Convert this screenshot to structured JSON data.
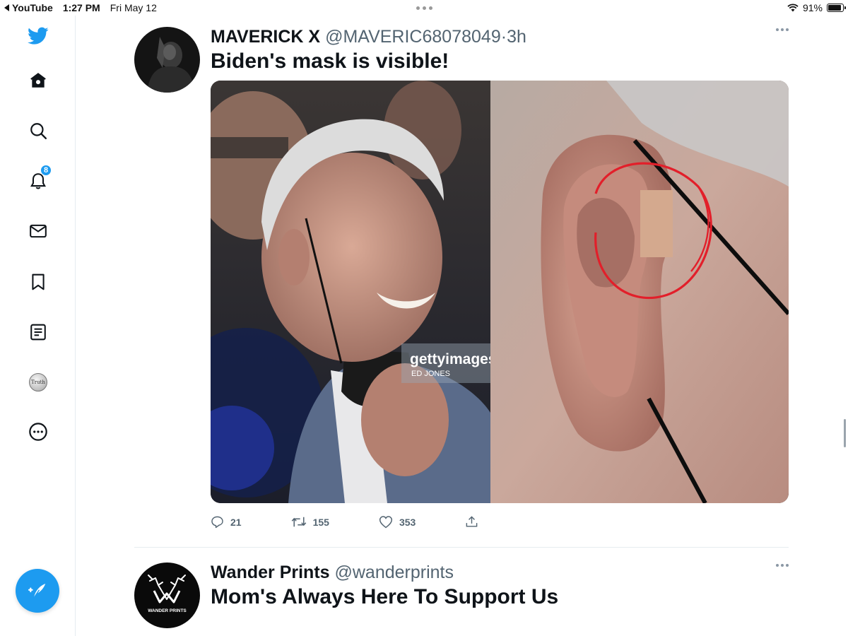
{
  "status_bar": {
    "back_app": "YouTube",
    "time": "1:27 PM",
    "date": "Fri May 12",
    "battery": "91%",
    "battery_level": 0.91
  },
  "sidebar": {
    "items": [
      {
        "name": "twitter-logo-icon"
      },
      {
        "name": "home-icon"
      },
      {
        "name": "search-icon"
      },
      {
        "name": "notifications-icon",
        "badge": "8"
      },
      {
        "name": "messages-icon"
      },
      {
        "name": "bookmarks-icon"
      },
      {
        "name": "lists-icon"
      },
      {
        "name": "truth-app-icon",
        "label": "Truth"
      },
      {
        "name": "more-icon"
      }
    ],
    "compose_icon": "compose-tweet-icon"
  },
  "tweets": [
    {
      "name": "MAVERICK X",
      "handle": "@MAVERIC68078049",
      "separator": "·",
      "time": "3h",
      "text": "Biden's mask is visible!",
      "media": {
        "watermark_brand": "gettyimages",
        "watermark_credit": "ED JONES"
      },
      "replies": "21",
      "retweets": "155",
      "likes": "353"
    },
    {
      "name": "Wander Prints",
      "handle": "@wanderprints",
      "text": "Mom's Always Here To Support Us",
      "avatar_text": "WANDER PRINTS"
    }
  ],
  "colors": {
    "accent": "#1d9bf0",
    "text": "#0f1419",
    "secondary": "#536471"
  }
}
